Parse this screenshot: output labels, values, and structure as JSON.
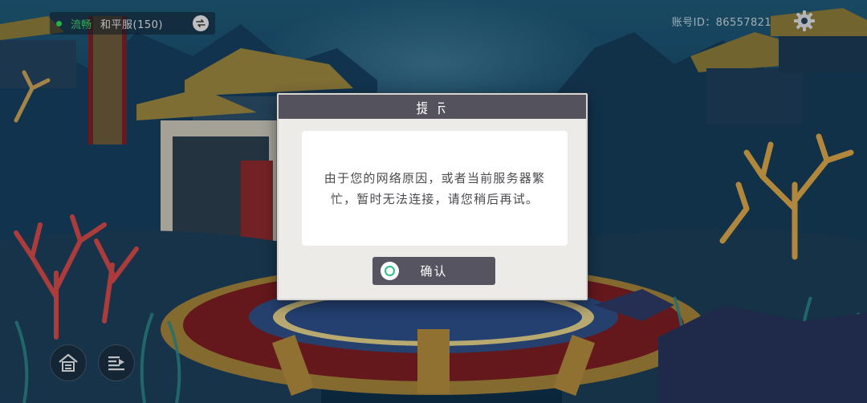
{
  "hud": {
    "connection_status": "流畅",
    "server_name": "和平服(150)",
    "account_id": "账号ID：86557821"
  },
  "dialog": {
    "title": "提示",
    "message": "由于您的网络原因，或者当前服务器繁忙，暂时无法连接，请您稍后再试。",
    "confirm_label": "确认"
  },
  "icons": {
    "switch": "swap-arrows-icon",
    "settings": "gear-icon",
    "home": "home-icon",
    "announcement": "announcement-icon",
    "confirm": "circle-confirm-icon"
  },
  "colors": {
    "status_green": "#3fd46a",
    "dialog_header": "#54525d",
    "confirm_ring": "#2fc08a"
  }
}
